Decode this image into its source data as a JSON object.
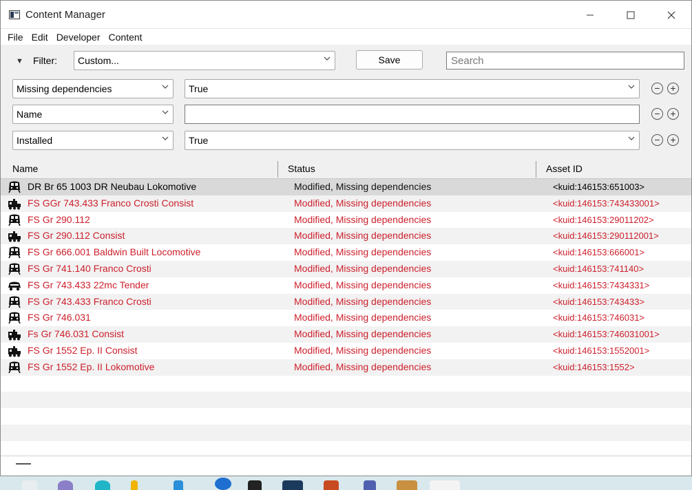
{
  "window": {
    "title": "Content Manager"
  },
  "menu": [
    "File",
    "Edit",
    "Developer",
    "Content"
  ],
  "filter": {
    "label": "Filter:",
    "preset": "Custom...",
    "save_label": "Save",
    "search_placeholder": "Search",
    "rules": [
      {
        "field": "Missing dependencies",
        "value": "True",
        "value_type": "dropdown"
      },
      {
        "field": "Name",
        "value": "",
        "value_type": "text"
      },
      {
        "field": "Installed",
        "value": "True",
        "value_type": "dropdown"
      }
    ]
  },
  "columns": {
    "name": "Name",
    "status": "Status",
    "asset_id": "Asset ID"
  },
  "status_color": "#cc1f2b",
  "rows": [
    {
      "icon": "locomotive-icon",
      "name": "DR Br 65 1003 DR Neubau Lokomotive",
      "status": "Modified, Missing dependencies",
      "kuid": "<kuid:146153:651003>",
      "highlight": false,
      "selected": true
    },
    {
      "icon": "consist-icon",
      "name": "FS GGr 743.433 Franco Crosti Consist",
      "status": "Modified, Missing dependencies",
      "kuid": "<kuid:146153:743433001>",
      "highlight": true
    },
    {
      "icon": "locomotive-icon",
      "name": "FS Gr 290.112",
      "status": "Modified, Missing dependencies",
      "kuid": "<kuid:146153:29011202>",
      "highlight": true
    },
    {
      "icon": "consist-icon",
      "name": "FS Gr 290.112 Consist",
      "status": "Modified, Missing dependencies",
      "kuid": "<kuid:146153:290112001>",
      "highlight": true
    },
    {
      "icon": "locomotive-icon",
      "name": "FS Gr 666.001 Baldwin Built Locomotive",
      "status": "Modified, Missing dependencies",
      "kuid": "<kuid:146153:666001>",
      "highlight": true
    },
    {
      "icon": "locomotive-icon",
      "name": "FS Gr 741.140 Franco Crosti",
      "status": "Modified, Missing dependencies",
      "kuid": "<kuid:146153:741140>",
      "highlight": true
    },
    {
      "icon": "tender-icon",
      "name": "FS Gr 743.433 22mc Tender",
      "status": "Modified, Missing dependencies",
      "kuid": "<kuid:146153:7434331>",
      "highlight": true
    },
    {
      "icon": "locomotive-icon",
      "name": "FS Gr 743.433 Franco Crosti",
      "status": "Modified, Missing dependencies",
      "kuid": "<kuid:146153:743433>",
      "highlight": true
    },
    {
      "icon": "locomotive-icon",
      "name": "FS Gr 746.031",
      "status": "Modified, Missing dependencies",
      "kuid": "<kuid:146153:746031>",
      "highlight": true
    },
    {
      "icon": "consist-icon",
      "name": "Fs Gr 746.031 Consist",
      "status": "Modified, Missing dependencies",
      "kuid": "<kuid:146153:746031001>",
      "highlight": true
    },
    {
      "icon": "consist-icon",
      "name": "FS Gr 1552 Ep. II Consist",
      "status": "Modified, Missing dependencies",
      "kuid": "<kuid:146153:1552001>",
      "highlight": true
    },
    {
      "icon": "locomotive-icon",
      "name": "FS Gr 1552 Ep. II Lokomotive",
      "status": "Modified, Missing dependencies",
      "kuid": "<kuid:146153:1552>",
      "highlight": true
    }
  ]
}
